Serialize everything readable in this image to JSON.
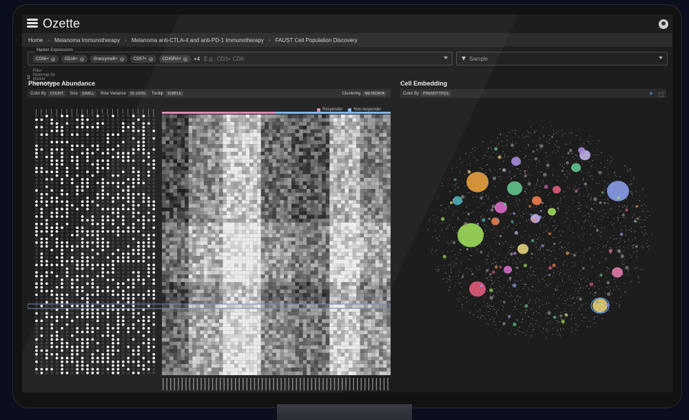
{
  "app": {
    "name": "Ozette"
  },
  "breadcrumb": [
    "Home",
    "Melanoma Immunotherapy",
    "Melanoma anti-CTLA-4 and anti-PD-1 Immunotherapy",
    "FAUST Cell Population Discovery"
  ],
  "filters": {
    "marker_expressions_label": "Marker Expressions",
    "chips": [
      "CD56+",
      "CD16+",
      "GranzymeB+",
      "CD57+",
      "CD45RA+"
    ],
    "more_count": "+4",
    "marker_placeholder": "E.g., CD3+ CD8-",
    "sample_placeholder": "Sample",
    "filter_checkbox_label": "Filter Heatmap by Marker Expressions"
  },
  "phenotype_panel": {
    "title": "Phenotype Abundance",
    "toolbar": {
      "color_by_label": "Color By",
      "color_by_value": "COUNT",
      "size_label": "Size",
      "size_value": "SMALL",
      "row_variance_label": "Row Variance",
      "row_variance_value": "35-100%",
      "tooltip_label": "Tooltip",
      "tooltip_value": "SIMPLE",
      "clustering_label": "Clustering",
      "clustering_value": "METADATA"
    },
    "legend": [
      {
        "label": "Responder",
        "color": "#d88bb5"
      },
      {
        "label": "Non-responder",
        "color": "#7fb4e6"
      }
    ]
  },
  "embedding_panel": {
    "title": "Cell Embedding",
    "toolbar": {
      "color_by_label": "Color By",
      "color_by_value": "PHENOTYPES"
    },
    "plus_icon": "plus-icon",
    "expand_icon": "square-icon"
  },
  "colors": {
    "background": "#1d1d1d",
    "accent": "#5aa9ff",
    "cluster_colors": [
      "#e7a040",
      "#9ddc5a",
      "#8a9ce8",
      "#63c48d",
      "#e15a7a",
      "#d86bc4",
      "#4db0b8",
      "#c2b2e8",
      "#e3d27a",
      "#ef7c4a",
      "#a88be0",
      "#e07ca8"
    ]
  }
}
